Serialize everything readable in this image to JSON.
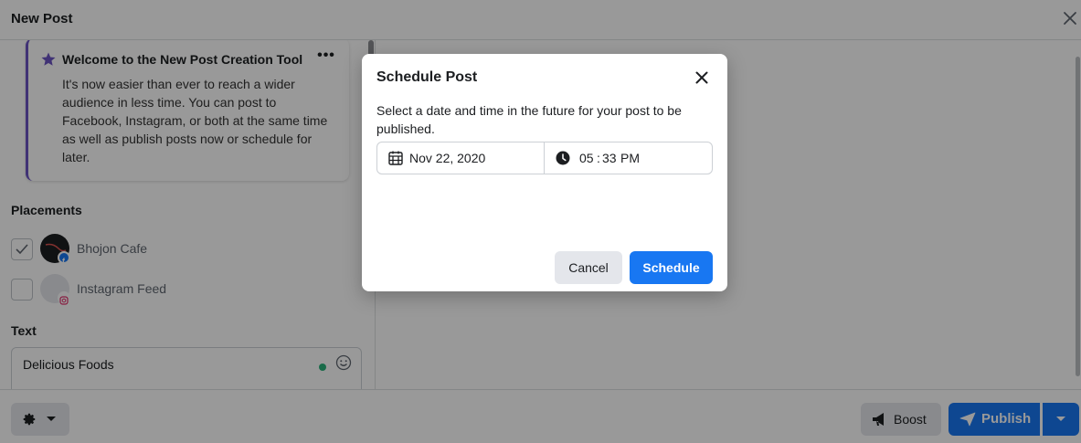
{
  "header": {
    "title": "New Post"
  },
  "welcome": {
    "title": "Welcome to the New Post Creation Tool",
    "more": "•••",
    "body": "It's now easier than ever to reach a wider audience in less time. You can post to Facebook, Instagram, or both at the same time as well as publish posts now or schedule for later."
  },
  "placements": {
    "label": "Placements",
    "items": [
      {
        "name": "Bhojon Cafe",
        "checked": true,
        "network": "facebook"
      },
      {
        "name": "Instagram Feed",
        "checked": false,
        "network": "instagram"
      }
    ]
  },
  "text_section": {
    "label": "Text",
    "value": "Delicious Foods"
  },
  "footer": {
    "boost_label": "Boost",
    "publish_label": "Publish"
  },
  "modal": {
    "title": "Schedule Post",
    "description": "Select a date and time in the future for your post to be published.",
    "date": "Nov 22, 2020",
    "time_hour": "05",
    "time_sep": ":",
    "time_minute": "33",
    "time_ampm": "PM",
    "cancel_label": "Cancel",
    "schedule_label": "Schedule"
  },
  "colors": {
    "accent": "#1877f2",
    "purple": "#6c54c4",
    "online": "#2ab27b"
  }
}
